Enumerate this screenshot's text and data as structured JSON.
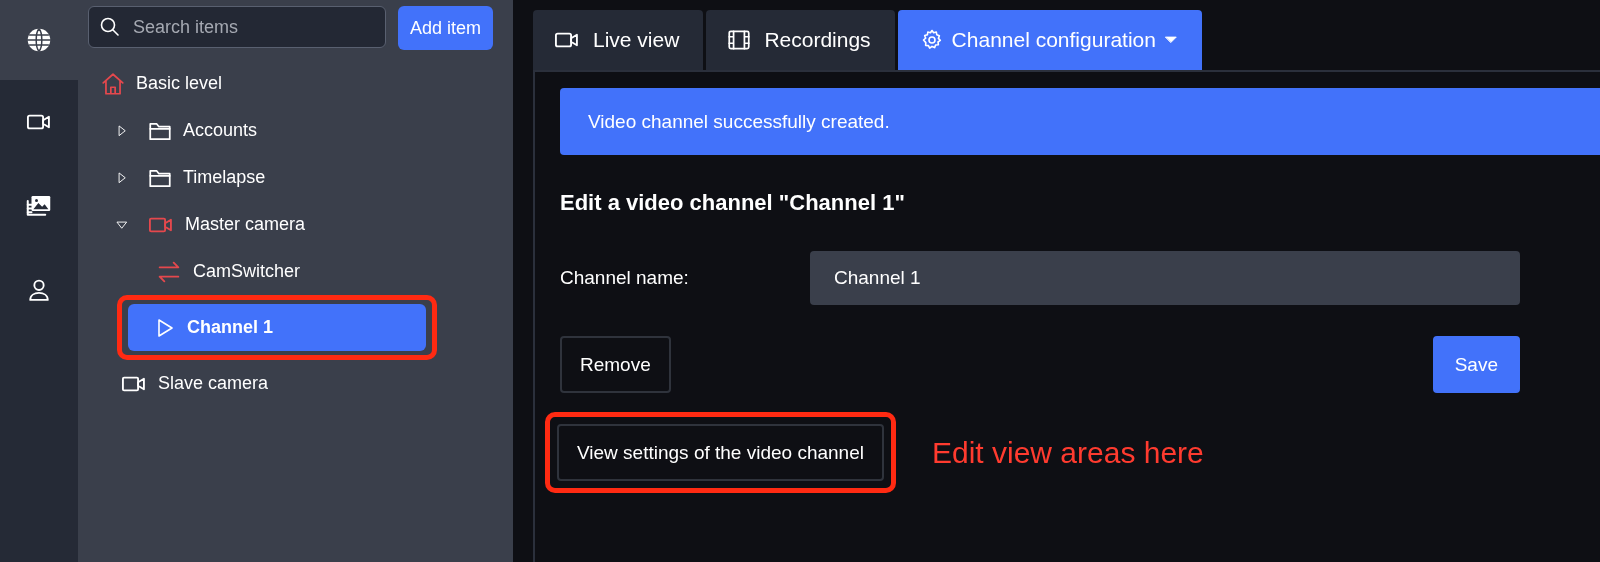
{
  "rail": {
    "items": [
      {
        "selected": true
      },
      {
        "selected": false
      },
      {
        "selected": false
      },
      {
        "selected": false
      }
    ]
  },
  "sidebar": {
    "search": {
      "placeholder": "Search items"
    },
    "add_button": "Add item",
    "tree": [
      {
        "label": "Basic level",
        "kind": "home",
        "color": "#e5484d",
        "selected": false,
        "annotated": false,
        "children": [
          {
            "label": "Accounts",
            "kind": "folder",
            "color": "#ffffff",
            "expanded": false,
            "selected": false,
            "annotated": false
          },
          {
            "label": "Timelapse",
            "kind": "folder",
            "color": "#ffffff",
            "expanded": false,
            "selected": false,
            "annotated": false
          },
          {
            "label": "Master camera",
            "kind": "camera",
            "color": "#e5484d",
            "expanded": true,
            "selected": false,
            "annotated": false,
            "children": [
              {
                "label": "CamSwitcher",
                "kind": "switcher",
                "color": "#e5484d",
                "selected": false,
                "annotated": false
              },
              {
                "label": "Channel 1",
                "kind": "channel",
                "color": "#ffffff",
                "selected": true,
                "annotated": true
              }
            ]
          },
          {
            "label": "Slave camera",
            "kind": "camera",
            "color": "#ffffff",
            "selected": false,
            "annotated": false
          }
        ]
      }
    ]
  },
  "tabs": [
    {
      "label": "Live view",
      "kind": "video",
      "selected": false,
      "dropdown": false
    },
    {
      "label": "Recordings",
      "kind": "film",
      "selected": false,
      "dropdown": false
    },
    {
      "label": "Channel configuration",
      "kind": "gear",
      "selected": true,
      "dropdown": true
    }
  ],
  "alert": "Video channel successfully created.",
  "form": {
    "heading": "Edit a video channel \"Channel 1\"",
    "fields": [
      {
        "label": "Channel name:",
        "value": "Channel 1"
      }
    ],
    "buttons": [
      {
        "label": "Remove",
        "kind": "outline",
        "annotated": false
      },
      {
        "label": "Save",
        "kind": "primary",
        "annotated": false
      },
      {
        "label": "View settings of the video channel",
        "kind": "outline",
        "annotated": true
      }
    ],
    "annotation": "Edit view areas here"
  }
}
